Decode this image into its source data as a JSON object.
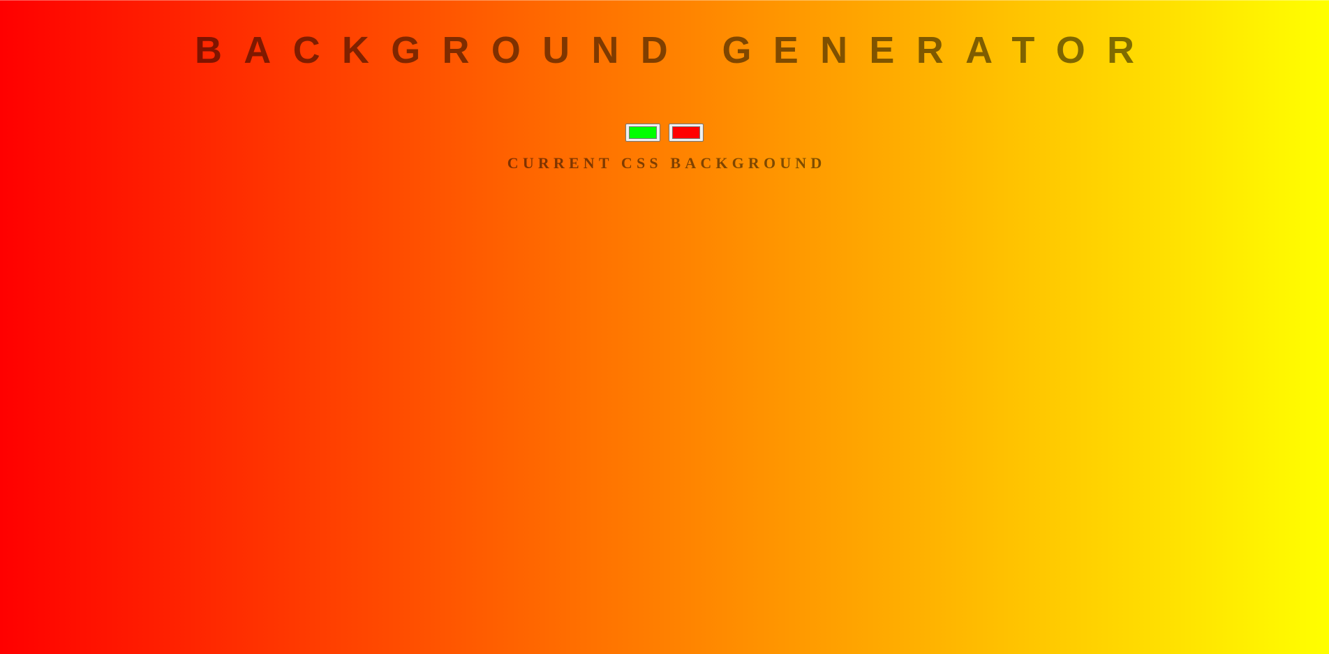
{
  "page": {
    "title": "BACKGROUND GENERATOR",
    "css_heading": "CURRENT CSS BACKGROUND"
  },
  "color_pickers": [
    {
      "name": "color1",
      "value": "#00ff00"
    },
    {
      "name": "color2",
      "value": "#ff0000"
    }
  ],
  "background": {
    "direction": "to right",
    "start_color": "#ff0000",
    "end_color": "#ffff00"
  }
}
